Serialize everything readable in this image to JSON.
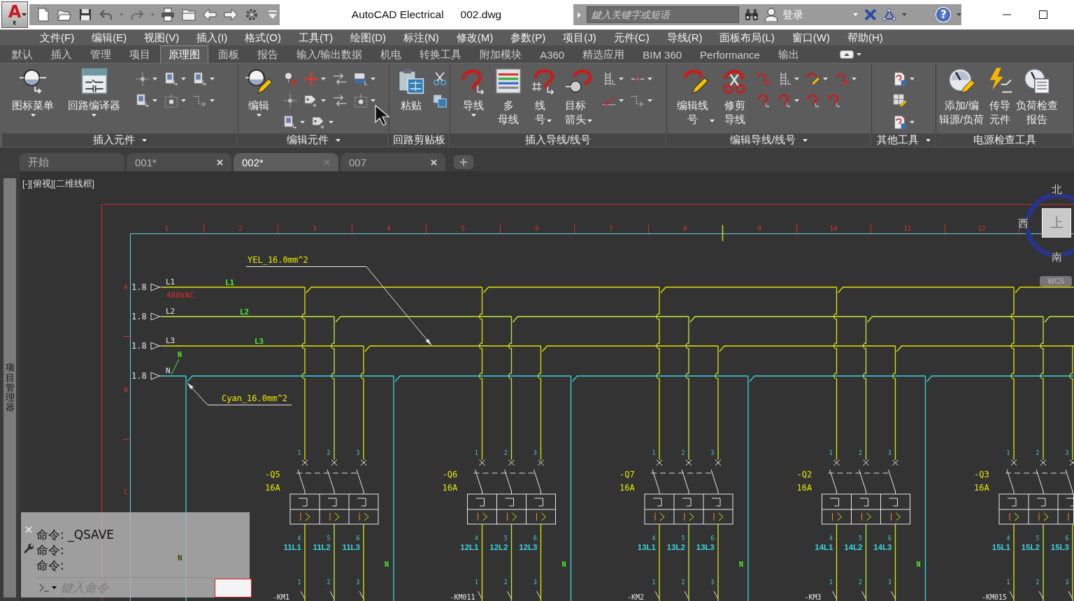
{
  "app_button": {
    "logo": "A",
    "badge": "E"
  },
  "title_bar": {
    "title": "AutoCAD Electrical",
    "file": "002.dwg",
    "search": {
      "placeholder": "鍵入关键字或短语"
    },
    "sign_in": "登录",
    "help": "?"
  },
  "menu": [
    "文件(F)",
    "编辑(E)",
    "视图(V)",
    "插入(I)",
    "格式(O)",
    "工具(T)",
    "绘图(D)",
    "标注(N)",
    "修改(M)",
    "参数(P)",
    "项目(J)",
    "元件(C)",
    "导线(R)",
    "面板布局(L)",
    "窗口(W)",
    "帮助(H)"
  ],
  "ribbon_tabs": [
    {
      "label": "默认",
      "selected": false
    },
    {
      "label": "插入",
      "selected": false
    },
    {
      "label": "管理",
      "selected": false
    },
    {
      "label": "项目",
      "selected": false
    },
    {
      "label": "原理图",
      "selected": true
    },
    {
      "label": "面板",
      "selected": false
    },
    {
      "label": "报告",
      "selected": false
    },
    {
      "label": "输入/输出数据",
      "selected": false
    },
    {
      "label": "机电",
      "selected": false
    },
    {
      "label": "转换工具",
      "selected": false
    },
    {
      "label": "附加模块",
      "selected": false
    },
    {
      "label": "A360",
      "selected": false
    },
    {
      "label": "精选应用",
      "selected": false
    },
    {
      "label": "BIM 360",
      "selected": false
    },
    {
      "label": "Performance",
      "selected": false
    },
    {
      "label": "输出",
      "selected": false
    }
  ],
  "ribbon_panels": [
    {
      "title": "插入元件",
      "expandable": true,
      "large": [
        {
          "label": "图标菜单",
          "dropdown": true
        },
        {
          "label": "回路编译器",
          "dropdown": true
        }
      ],
      "small_rows": [
        [
          {
            "dropdown": true
          },
          {
            "dropdown": true
          },
          {
            "dropdown": true
          }
        ],
        [
          {
            "dropdown": true
          },
          {
            "dropdown": true
          },
          {
            "dropdown": true
          }
        ]
      ]
    },
    {
      "title": "编辑元件",
      "expandable": true,
      "large": [
        {
          "label": "编辑",
          "dropdown": true
        }
      ],
      "small_rows": [
        [
          {
            "dropdown": false
          },
          {
            "dropdown": true
          },
          {
            "dropdown": false
          },
          {
            "dropdown": true
          }
        ],
        [
          {
            "dropdown": false
          },
          {
            "dropdown": true
          },
          {
            "dropdown": false
          },
          {
            "dropdown": true
          }
        ],
        [
          {
            "dropdown": true
          },
          {
            "dropdown": true
          }
        ]
      ]
    },
    {
      "title": "回路剪贴板",
      "expandable": false,
      "large": [
        {
          "label": "粘贴",
          "dropdown": false
        }
      ],
      "small_rows": [
        [
          {
            "dropdown": false
          }
        ],
        [
          {
            "dropdown": false
          }
        ]
      ]
    },
    {
      "title": "插入导线/线号",
      "expandable": false,
      "large": [
        {
          "label": "导线",
          "dropdown": true
        },
        {
          "label": "多母线",
          "dropdown": false
        },
        {
          "label": "线号",
          "dropdown": true
        },
        {
          "label": "目标箭头",
          "dropdown": true
        }
      ],
      "small_rows": [
        [
          {
            "dropdown": true
          },
          {
            "dropdown": true
          }
        ],
        [
          {
            "dropdown": true
          },
          {
            "dropdown": true
          }
        ]
      ]
    },
    {
      "title": "编辑导线/线号",
      "expandable": true,
      "large": [
        {
          "label": "编辑线号",
          "dropdown": true
        },
        {
          "label": "修剪导线",
          "dropdown": false
        }
      ],
      "small_rows": [
        [
          {
            "dropdown": false
          },
          {
            "dropdown": true
          },
          {
            "dropdown": true
          },
          {
            "dropdown": true
          }
        ],
        [
          {
            "dropdown": false
          },
          {
            "dropdown": true
          },
          {
            "dropdown": false
          },
          {
            "dropdown": false
          }
        ]
      ]
    },
    {
      "title": "其他工具",
      "expandable": true,
      "small_rows": [
        [
          {
            "dropdown": true
          }
        ],
        [
          {
            "dropdown": false
          }
        ],
        [
          {
            "dropdown": true
          }
        ]
      ]
    },
    {
      "title": "电源检查工具",
      "expandable": false,
      "large": [
        {
          "label": "添加/编辑源/负荷",
          "dropdown": false
        },
        {
          "label": "传导元件",
          "dropdown": false
        },
        {
          "label": "负荷检查报告",
          "dropdown": false
        }
      ]
    }
  ],
  "doc_tabs": [
    {
      "label": "开始",
      "selected": false,
      "closable": false
    },
    {
      "label": "001*",
      "selected": false,
      "closable": true
    },
    {
      "label": "002*",
      "selected": true,
      "closable": true
    },
    {
      "label": "007",
      "selected": false,
      "closable": true
    }
  ],
  "palette": {
    "title": "项目管理器"
  },
  "viewport": {
    "label": "[-][俯视][二维线框]",
    "viewcube": {
      "north": "北",
      "west": "西",
      "top": "上",
      "south": "南",
      "coordinate_system": "WCS"
    }
  },
  "schematic": {
    "columns": [
      "1",
      "2",
      "3",
      "4",
      "5",
      "6",
      "7",
      "8",
      "9",
      "10",
      "11",
      "12"
    ],
    "rows": [
      "A",
      "B",
      "C"
    ],
    "buses": [
      {
        "kind": "phase",
        "source": "1.8",
        "name": "L1",
        "wire_number": "L1",
        "voltage": "480VAC",
        "color": "#e4e400"
      },
      {
        "kind": "phase",
        "source": "1.8",
        "name": "L2",
        "wire_number": "L2",
        "color": "#c0ec3a"
      },
      {
        "kind": "phase",
        "source": "1.8",
        "name": "L3",
        "wire_number": "L3",
        "color": "#e4e400"
      },
      {
        "kind": "neutral",
        "source": "1.8",
        "name": "N",
        "wire_number": "N",
        "color": "#3cd4de"
      }
    ],
    "callouts": [
      "YEL_16.0mm^2",
      "Cyan_16.0mm^2"
    ],
    "breakers": [
      {
        "tag": "-Q5",
        "rating": "16A",
        "line_terminals": [
          "1",
          "2",
          "3"
        ],
        "load_terminals": [
          "4",
          "5",
          "6"
        ],
        "wire_numbers": [
          "11L1",
          "11L2",
          "11L3"
        ],
        "contactor_terminals": [
          "1",
          "2",
          "3"
        ],
        "contactor": "-KM1"
      },
      {
        "tag": "-Q6",
        "rating": "16A",
        "line_terminals": [
          "1",
          "2",
          "3"
        ],
        "load_terminals": [
          "4",
          "5",
          "6"
        ],
        "wire_numbers": [
          "12L1",
          "12L2",
          "12L3"
        ],
        "contactor_terminals": [
          "1",
          "2",
          "3"
        ],
        "contactor": "-KM011"
      },
      {
        "tag": "-Q7",
        "rating": "16A",
        "line_terminals": [
          "1",
          "2",
          "3"
        ],
        "load_terminals": [
          "4",
          "5",
          "6"
        ],
        "wire_numbers": [
          "13L1",
          "13L2",
          "13L3"
        ],
        "contactor_terminals": [
          "1",
          "2",
          "3"
        ],
        "contactor": "-KM2"
      },
      {
        "tag": "-Q2",
        "rating": "16A",
        "line_terminals": [
          "1",
          "2",
          "3"
        ],
        "load_terminals": [
          "4",
          "5",
          "6"
        ],
        "wire_numbers": [
          "14L1",
          "14L2",
          "14L3"
        ],
        "contactor_terminals": [
          "1",
          "2",
          "3"
        ],
        "contactor": "-KM3"
      },
      {
        "tag": "-Q3",
        "rating": "16A",
        "line_terminals": [
          "1",
          "2",
          "3"
        ],
        "load_terminals": [
          "4",
          "5",
          "6"
        ],
        "wire_numbers": [
          "15L1",
          "15L2",
          "15L3"
        ],
        "contactor_terminals": [
          "1",
          "2",
          "3"
        ],
        "contactor": "-KM015"
      }
    ],
    "neutral_markers": [
      "N",
      "N",
      "N",
      "N",
      "N"
    ]
  },
  "command_line": {
    "history": [
      "命令: _QSAVE",
      "命令:",
      "命令:"
    ],
    "placeholder": "鍵入命令"
  }
}
